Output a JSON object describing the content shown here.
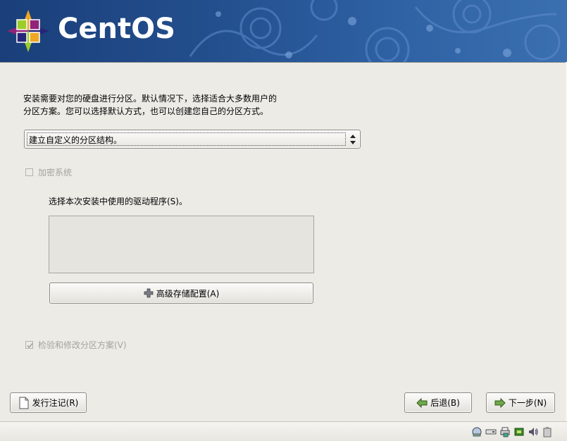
{
  "banner": {
    "brand": "CentOS"
  },
  "intro": {
    "line1": "安装需要对您的硬盘进行分区。默认情况下，选择适合大多数用户的",
    "line2": "分区方案。您可以选择默认方式，也可以创建您自己的分区方式。"
  },
  "partition_combo": {
    "selected": "建立自定义的分区结构。"
  },
  "encrypt": {
    "label": "加密系统",
    "checked": false,
    "enabled": false
  },
  "drivers": {
    "label": "选择本次安装中使用的驱动程序(S)。",
    "items": []
  },
  "advanced_button": {
    "label": "高级存储配置(A)"
  },
  "review": {
    "label": "检验和修改分区方案(V)",
    "checked": true,
    "enabled": false
  },
  "buttons": {
    "release_notes": "发行注记(R)",
    "back": "后退(B)",
    "next": "下一步(N)"
  },
  "colors": {
    "banner": "#24508f",
    "background": "#edebe6",
    "disabled_text": "#a5a39d"
  },
  "tray_icons": [
    "network-icon",
    "drive-icon",
    "printer-icon",
    "chip-icon",
    "speaker-icon",
    "clipboard-icon"
  ]
}
